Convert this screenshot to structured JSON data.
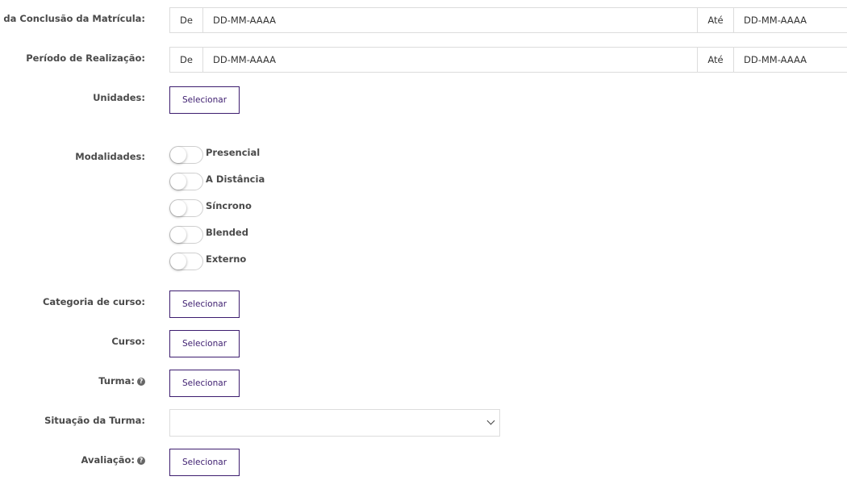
{
  "filters": {
    "conclusao": {
      "label": "Data da Conclusão da Matrícula:",
      "from_label": "De",
      "from_placeholder": "DD-MM-AAAA",
      "to_label": "Até",
      "to_placeholder": "DD-MM-AAAA"
    },
    "periodo": {
      "label": "Período de Realização:",
      "from_label": "De",
      "from_placeholder": "DD-MM-AAAA",
      "to_label": "Até",
      "to_placeholder": "DD-MM-AAAA"
    },
    "unidades": {
      "label": "Unidades:",
      "button": "Selecionar"
    },
    "modalidades": {
      "label": "Modalidades:",
      "options": [
        {
          "label": "Presencial",
          "checked": false
        },
        {
          "label": "A Distância",
          "checked": false
        },
        {
          "label": "Síncrono",
          "checked": false
        },
        {
          "label": "Blended",
          "checked": false
        },
        {
          "label": "Externo",
          "checked": false
        }
      ]
    },
    "categoria": {
      "label": "Categoria de curso:",
      "button": "Selecionar"
    },
    "curso": {
      "label": "Curso:",
      "button": "Selecionar"
    },
    "turma": {
      "label": "Turma:",
      "button": "Selecionar",
      "help": "?"
    },
    "situacao": {
      "label": "Situação da Turma:",
      "value": ""
    },
    "avaliacao": {
      "label": "Avaliação:",
      "button": "Selecionar",
      "help": "?"
    }
  },
  "colors": {
    "accent": "#3d1d6f",
    "border": "#dcdcdc",
    "label": "#4a4a4a"
  }
}
